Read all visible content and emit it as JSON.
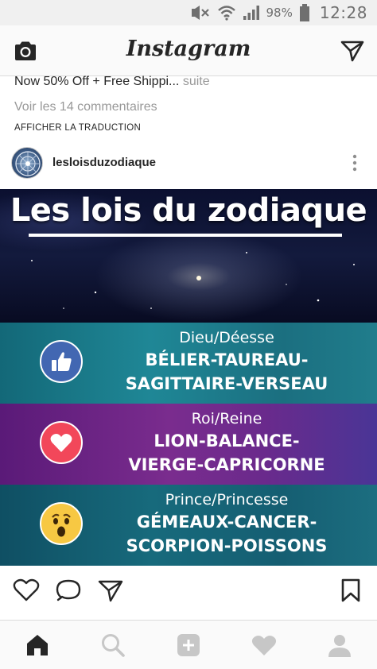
{
  "status_bar": {
    "battery_percent": "98%",
    "time": "12:28",
    "icons": [
      "mute-icon",
      "wifi-icon",
      "signal-icon",
      "battery-icon"
    ]
  },
  "app_header": {
    "logo": "Instagram",
    "left_icon": "camera-icon",
    "right_icon": "direct-message-icon"
  },
  "previous_post": {
    "caption": "Now 50% Off + Free Shippi...",
    "more_label": "suite",
    "comments_link": "Voir les 14 commentaires",
    "translate_link": "AFFICHER LA TRADUCTION"
  },
  "post": {
    "username": "lesloisduzodiaque",
    "menu_icon": "more-vertical-icon",
    "image": {
      "title": "Les lois du zodiaque",
      "groups": [
        {
          "role": "Dieu/Déesse",
          "line1": "BÉLIER-TAUREAU-",
          "line2": "SAGITTAIRE-VERSEAU",
          "reaction": "like-icon"
        },
        {
          "role": "Roi/Reine",
          "line1": "LION-BALANCE-",
          "line2": "VIERGE-CAPRICORNE",
          "reaction": "love-icon"
        },
        {
          "role": "Prince/Princesse",
          "line1": "GÉMEAUX-CANCER-",
          "line2": "SCORPION-POISSONS",
          "reaction": "wow-icon"
        }
      ]
    },
    "actions": [
      "heart-icon",
      "comment-icon",
      "share-icon",
      "bookmark-icon"
    ]
  },
  "bottom_nav": [
    "home-icon",
    "search-icon",
    "add-post-icon",
    "activity-icon",
    "profile-icon"
  ],
  "colors": {
    "text": "#262626",
    "muted": "#999999",
    "like_blue": "#4267b2",
    "love_red": "#f2475a",
    "wow_yellow": "#f7c843"
  }
}
